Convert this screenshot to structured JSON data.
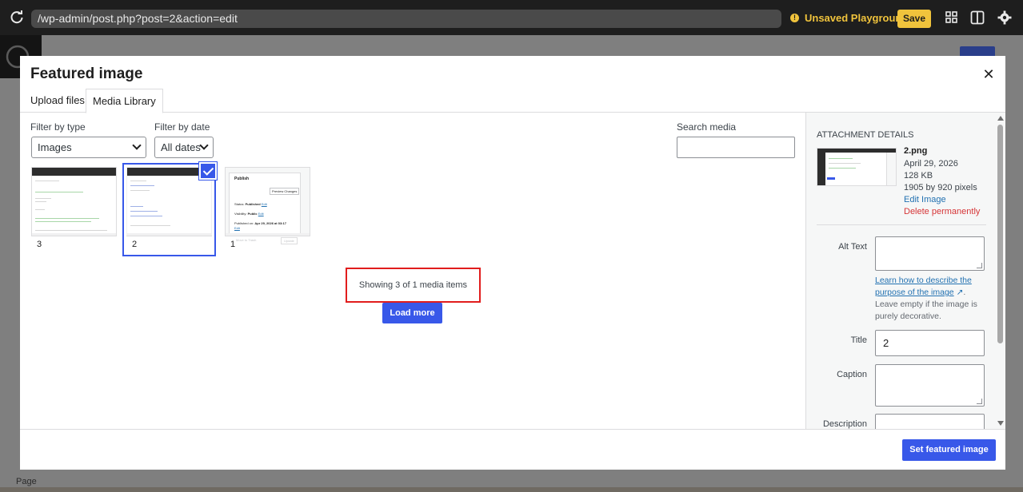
{
  "topbar": {
    "url": "/wp-admin/post.php?post=2&action=edit",
    "unsaved_label": "Unsaved Playground",
    "save_label": "Save"
  },
  "background": {
    "page_label": "Page"
  },
  "modal": {
    "title": "Featured image",
    "tabs": [
      {
        "label": "Upload files"
      },
      {
        "label": "Media Library"
      }
    ],
    "filters": {
      "type_label": "Filter by type",
      "type_value": "Images",
      "date_label": "Filter by date",
      "date_value": "All dates",
      "search_label": "Search media",
      "search_value": ""
    },
    "attachments": [
      {
        "label": "3",
        "selected": false
      },
      {
        "label": "2",
        "selected": true
      },
      {
        "label": "1",
        "selected": false
      }
    ],
    "publish_preview": {
      "title": "Publish",
      "preview_button": "Preview Changes",
      "status_label": "Status:",
      "status_value": "Published",
      "visibility_label": "Visibility:",
      "visibility_value": "Public",
      "published_label": "Published on:",
      "published_value": "Apr 29, 2026 at 03:17",
      "edit_link": "Edit",
      "move_to_trash": "Move to Trash",
      "update_button": "Update"
    },
    "status_text": "Showing 3 of 1 media items",
    "load_more": "Load more",
    "details": {
      "heading": "ATTACHMENT DETAILS",
      "filename": "2.png",
      "date": "April 29, 2026",
      "size": "128 KB",
      "dimensions": "1905 by 920 pixels",
      "edit_image": "Edit Image",
      "delete_permanently": "Delete permanently",
      "alt_text_label": "Alt Text",
      "alt_text_value": "",
      "alt_help_link_1": "Learn how to describe the",
      "alt_help_link_2": "purpose of the image",
      "alt_help_text": "Leave empty if the image is purely decorative.",
      "title_label": "Title",
      "title_value": "2",
      "caption_label": "Caption",
      "caption_value": "",
      "description_label": "Description",
      "description_value": ""
    },
    "set_featured_label": "Set featured image"
  },
  "colors": {
    "accent": "#3858e9",
    "warning": "#f0c33c",
    "highlight_border": "#e11d1d",
    "delete": "#d63638",
    "link": "#2271b1"
  }
}
